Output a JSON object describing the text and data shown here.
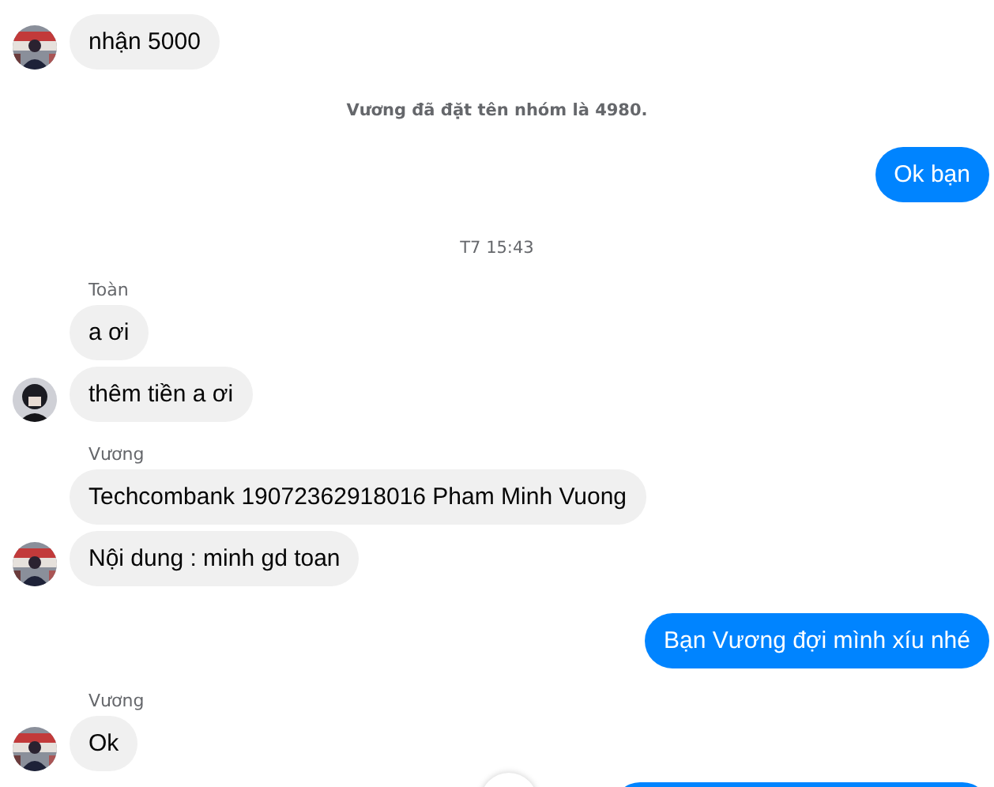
{
  "messages": [
    {
      "kind": "incoming",
      "avatar": {
        "kind": "picture"
      },
      "bubbles": [
        "nhận 5000"
      ]
    },
    {
      "kind": "system",
      "text": "Vương đã đặt tên nhóm là 4980."
    },
    {
      "kind": "outgoing",
      "bubbles": [
        "Ok bạn"
      ]
    },
    {
      "kind": "time",
      "text": "T7 15:43"
    },
    {
      "kind": "incoming",
      "sender": "Toàn",
      "avatar": {
        "kind": "picture"
      },
      "bubbles": [
        "a ơi",
        "thêm tiền a ơi"
      ]
    },
    {
      "kind": "incoming",
      "sender": "Vương",
      "avatar": {
        "kind": "picture"
      },
      "bubbles": [
        "Techcombank 19072362918016 Pham Minh Vuong",
        "Nội dung : minh gd toan"
      ]
    },
    {
      "kind": "outgoing",
      "bubbles": [
        "Bạn Vương đợi mình xíu nhé"
      ]
    },
    {
      "kind": "incoming",
      "sender": "Vương",
      "avatar": {
        "kind": "picture"
      },
      "bubbles": [
        "Ok"
      ]
    }
  ]
}
